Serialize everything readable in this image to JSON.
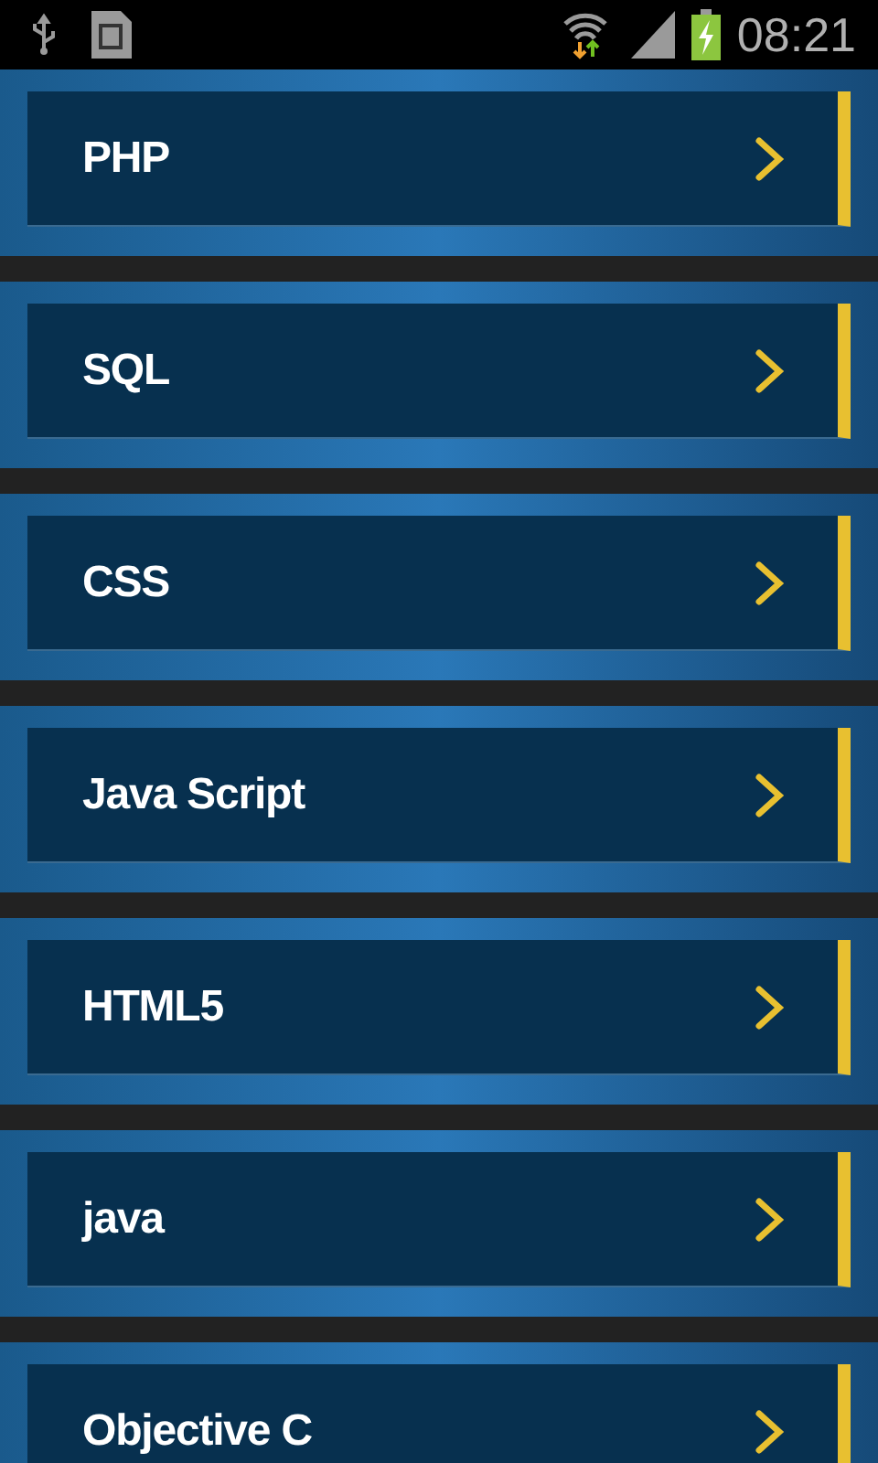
{
  "status_bar": {
    "time": "08:21"
  },
  "items": [
    {
      "label": "PHP"
    },
    {
      "label": "SQL"
    },
    {
      "label": "CSS"
    },
    {
      "label": "Java Script"
    },
    {
      "label": "HTML5"
    },
    {
      "label": "java"
    },
    {
      "label": "Objective C"
    }
  ]
}
